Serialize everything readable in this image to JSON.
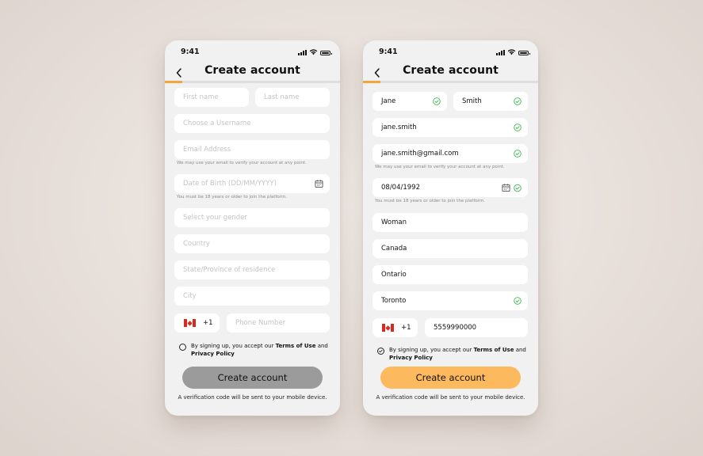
{
  "colors": {
    "accent": "#f5a53c",
    "button_active": "#fdb95e",
    "button_disabled": "#9b9b9b",
    "valid_check": "#3cb54a"
  },
  "screens": [
    {
      "status_time": "9:41",
      "title": "Create account",
      "progress": 0.1,
      "first_name": {
        "placeholder": "First name",
        "value": ""
      },
      "last_name": {
        "placeholder": "Last name",
        "value": ""
      },
      "username": {
        "placeholder": "Choose a Username",
        "value": ""
      },
      "email": {
        "placeholder": "Email Address",
        "value": ""
      },
      "email_hint": "We may use your email to verify your account at any point.",
      "dob": {
        "placeholder": "Date of Birth (DD/MM/YYYY)",
        "value": ""
      },
      "dob_hint": "You must be 18 years or older to join the platform.",
      "gender": {
        "placeholder": "Select your gender",
        "value": ""
      },
      "country": {
        "placeholder": "Country",
        "value": ""
      },
      "state": {
        "placeholder": "State/Province of residence",
        "value": ""
      },
      "city": {
        "placeholder": "City",
        "value": ""
      },
      "country_code": "+1",
      "phone": {
        "placeholder": "Phone Number",
        "value": ""
      },
      "terms": {
        "prefix": "By signing up, you accept our ",
        "terms_link": "Terms of Use",
        "and": " and ",
        "privacy_link": "Privacy Policy",
        "checked": false
      },
      "cta_label": "Create account",
      "cta_enabled": false,
      "footnote": "A verification code will be sent to your mobile device."
    },
    {
      "status_time": "9:41",
      "title": "Create account",
      "progress": 0.1,
      "first_name": {
        "placeholder": "First name",
        "value": "Jane"
      },
      "last_name": {
        "placeholder": "Last name",
        "value": "Smith"
      },
      "username": {
        "placeholder": "Choose a Username",
        "value": "jane.smith"
      },
      "email": {
        "placeholder": "Email Address",
        "value": "jane.smith@gmail.com"
      },
      "email_hint": "We may use your email to verify your account at any point.",
      "dob": {
        "placeholder": "Date of Birth (DD/MM/YYYY)",
        "value": "08/04/1992"
      },
      "dob_hint": "You must be 18 years or older to join the platform.",
      "gender": {
        "placeholder": "Select your gender",
        "value": "Woman"
      },
      "country": {
        "placeholder": "Country",
        "value": "Canada"
      },
      "state": {
        "placeholder": "State/Province of residence",
        "value": "Ontario"
      },
      "city": {
        "placeholder": "City",
        "value": "Toronto"
      },
      "country_code": "+1",
      "phone": {
        "placeholder": "Phone Number",
        "value": "5559990000"
      },
      "terms": {
        "prefix": "By signing up, you accept our ",
        "terms_link": "Terms of Use",
        "and": " and ",
        "privacy_link": "Privacy Policy",
        "checked": true
      },
      "cta_label": "Create account",
      "cta_enabled": true,
      "footnote": "A verification code will be sent to your mobile device."
    }
  ]
}
